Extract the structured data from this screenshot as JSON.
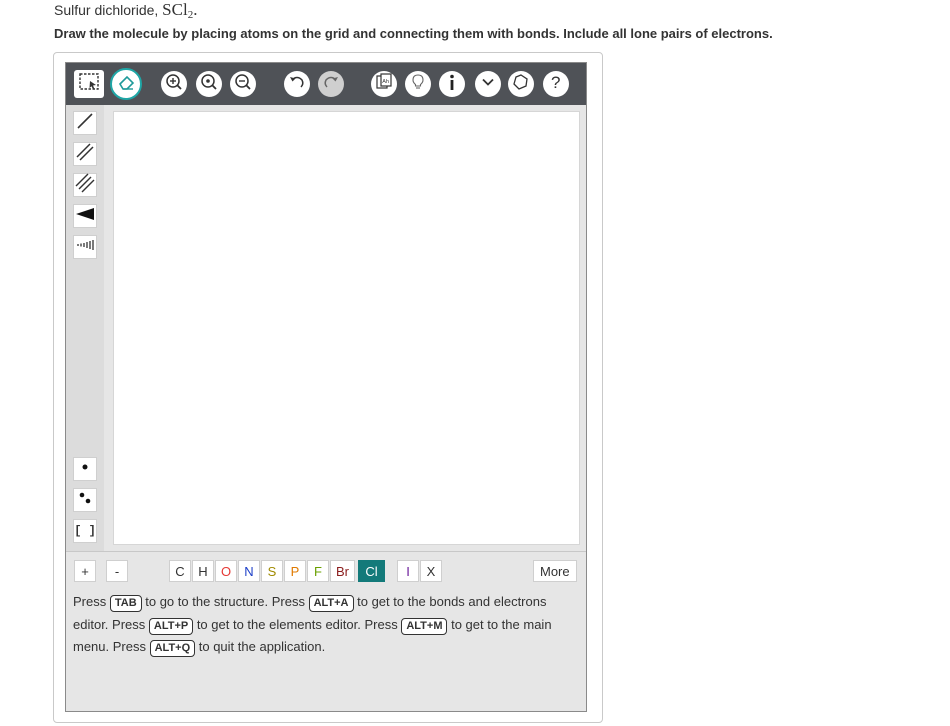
{
  "question": {
    "title_prefix": "Sulfur dichloride,",
    "formula_main": "SCl",
    "formula_sub": "2",
    "formula_end": ".",
    "instruction": "Draw the molecule by placing atoms on the grid and connecting them with bonds. Include all lone pairs of electrons."
  },
  "toolbar": {
    "icons": [
      "select-icon",
      "eraser-icon",
      "zoom-in-icon",
      "zoom-reset-icon",
      "zoom-out-icon",
      "undo-icon",
      "redo-icon",
      "template-icon",
      "hint-icon",
      "info-icon",
      "chevron-down-icon",
      "clean-icon",
      "help-icon"
    ]
  },
  "left_tools": [
    "single-bond",
    "double-bond",
    "triple-bond",
    "wedge-bond",
    "hash-bond",
    "radical",
    "lone-pair",
    "brackets"
  ],
  "brackets_label": "[ ]",
  "elements": {
    "plus": "+",
    "minus": "-",
    "list": [
      {
        "symbol": "C",
        "color": "#333333"
      },
      {
        "symbol": "H",
        "color": "#333333"
      },
      {
        "symbol": "O",
        "color": "#e53935"
      },
      {
        "symbol": "N",
        "color": "#1e40c8"
      },
      {
        "symbol": "S",
        "color": "#a08a00"
      },
      {
        "symbol": "P",
        "color": "#e07a00"
      },
      {
        "symbol": "F",
        "color": "#6aa000"
      },
      {
        "symbol": "Br",
        "color": "#8b1d1d"
      },
      {
        "symbol": "Cl",
        "color": "#ffffff"
      },
      {
        "symbol": "I",
        "color": "#6a1b9a"
      },
      {
        "symbol": "X",
        "color": "#333333"
      }
    ],
    "more": "More"
  },
  "help": {
    "t1": "Press ",
    "k1": "TAB",
    "t2": " to go to the structure. Press ",
    "k2": "ALT+A",
    "t3": " to get to the bonds and electrons editor. Press ",
    "k3": "ALT+P",
    "t4": " to get to the elements editor. Press ",
    "k4": "ALT+M",
    "t5": " to get to the main menu. Press ",
    "k5": "ALT+Q",
    "t6": " to quit the application."
  }
}
